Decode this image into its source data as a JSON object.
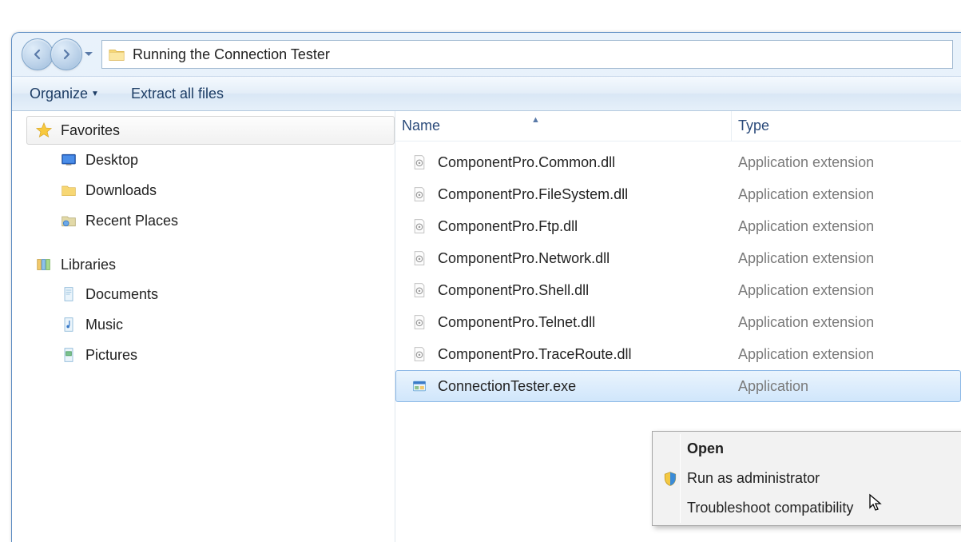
{
  "path": "Running the Connection Tester",
  "toolbar": {
    "organize": "Organize",
    "extract": "Extract all files"
  },
  "sidebar": {
    "favorites": {
      "label": "Favorites"
    },
    "fav_items": [
      {
        "label": "Desktop",
        "icon": "desktop"
      },
      {
        "label": "Downloads",
        "icon": "downloads"
      },
      {
        "label": "Recent Places",
        "icon": "recent"
      }
    ],
    "libraries": {
      "label": "Libraries"
    },
    "lib_items": [
      {
        "label": "Documents",
        "icon": "documents"
      },
      {
        "label": "Music",
        "icon": "music"
      },
      {
        "label": "Pictures",
        "icon": "pictures"
      }
    ]
  },
  "columns": {
    "name": "Name",
    "type": "Type"
  },
  "files": [
    {
      "name": "ComponentPro.Common.dll",
      "type": "Application extension",
      "icon": "dll"
    },
    {
      "name": "ComponentPro.FileSystem.dll",
      "type": "Application extension",
      "icon": "dll"
    },
    {
      "name": "ComponentPro.Ftp.dll",
      "type": "Application extension",
      "icon": "dll"
    },
    {
      "name": "ComponentPro.Network.dll",
      "type": "Application extension",
      "icon": "dll"
    },
    {
      "name": "ComponentPro.Shell.dll",
      "type": "Application extension",
      "icon": "dll"
    },
    {
      "name": "ComponentPro.Telnet.dll",
      "type": "Application extension",
      "icon": "dll"
    },
    {
      "name": "ComponentPro.TraceRoute.dll",
      "type": "Application extension",
      "icon": "dll"
    },
    {
      "name": "ConnectionTester.exe",
      "type": "Application",
      "icon": "exe",
      "selected": true
    }
  ],
  "context_menu": [
    {
      "label": "Open",
      "bold": true
    },
    {
      "label": "Run as administrator",
      "icon": "shield"
    },
    {
      "label": "Troubleshoot compatibility"
    }
  ]
}
